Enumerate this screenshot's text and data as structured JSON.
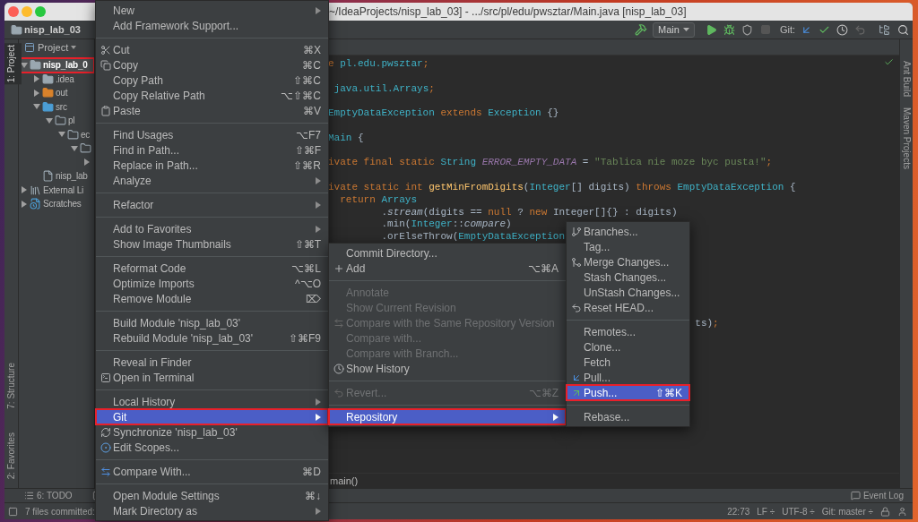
{
  "window": {
    "title": "~/IdeaProjects/nisp_lab_03] - .../src/pl/edu/pwsztar/Main.java [nisp_lab_03]"
  },
  "navbar": {
    "project": "nisp_lab_03",
    "run_config": "Main",
    "git_label": "Git:"
  },
  "left_stripe": {
    "top": [
      {
        "label": "1: Project",
        "selected": true
      }
    ],
    "bottom": [
      {
        "label": "7: Structure",
        "selected": false
      },
      {
        "label": "2: Favorites",
        "selected": false
      }
    ]
  },
  "right_stripe": [
    {
      "label": "Ant Build"
    },
    {
      "label": "Maven Projects"
    }
  ],
  "project_panel": {
    "header": "Project",
    "tree": [
      {
        "kind": "module",
        "label": "nisp_lab_0",
        "expanded": true,
        "marked": true,
        "children": [
          {
            "kind": "folder",
            "label": ".idea",
            "expanded": false
          },
          {
            "kind": "output",
            "label": "out",
            "expanded": false
          },
          {
            "kind": "source",
            "label": "src",
            "expanded": true,
            "children": [
              {
                "kind": "package",
                "label": "pl",
                "expanded": true,
                "children": [
                  {
                    "kind": "package",
                    "label": "ec",
                    "expanded": true,
                    "children": [
                      {
                        "kind": "package",
                        "expanded": true,
                        "children": [
                          {
                            "expanded": false
                          }
                        ]
                      }
                    ]
                  }
                ]
              }
            ]
          },
          {
            "kind": "file",
            "label": "nisp_lab"
          }
        ]
      },
      {
        "kind": "library",
        "label": "External Li",
        "expanded": false
      },
      {
        "kind": "scratches",
        "label": "Scratches",
        "expanded": false
      }
    ]
  },
  "editor": {
    "lines": [
      {
        "kind": "code",
        "tokens": [
          {
            "text": "e",
            "kind": "keyword"
          },
          {
            "text": " pl.edu.pwsztar",
            "kind": "type"
          },
          {
            "text": ";",
            "kind": "keyword"
          }
        ]
      },
      {
        "kind": "blank"
      },
      {
        "kind": "code",
        "tokens": [
          {
            "text": " java.util.Arrays",
            "kind": "type"
          },
          {
            "text": ";",
            "kind": "keyword"
          }
        ]
      },
      {
        "kind": "blank"
      },
      {
        "kind": "code",
        "tokens": [
          {
            "text": "EmptyDataException",
            "kind": "type"
          },
          {
            "text": " extends ",
            "kind": "keyword"
          },
          {
            "text": "Exception",
            "kind": "type"
          },
          {
            "text": " {}",
            "kind": "plain"
          }
        ]
      },
      {
        "kind": "blank"
      },
      {
        "kind": "code",
        "tokens": [
          {
            "text": "Main",
            "kind": "type"
          },
          {
            "text": " {",
            "kind": "plain"
          }
        ]
      },
      {
        "kind": "blank"
      },
      {
        "kind": "code",
        "tokens": [
          {
            "text": "ivate final static ",
            "kind": "keyword"
          },
          {
            "text": "String ",
            "kind": "type"
          },
          {
            "text": "ERROR_EMPTY_DATA",
            "kind": "constant"
          },
          {
            "text": " = ",
            "kind": "plain"
          },
          {
            "text": "\"Tablica nie moze byc pusta!\"",
            "kind": "string"
          },
          {
            "text": ";",
            "kind": "keyword"
          }
        ]
      },
      {
        "kind": "blank"
      },
      {
        "kind": "code",
        "tokens": [
          {
            "text": "ivate static int ",
            "kind": "keyword"
          },
          {
            "text": "getMinFromDigits",
            "kind": "method"
          },
          {
            "text": "(",
            "kind": "plain"
          },
          {
            "text": "Integer",
            "kind": "type"
          },
          {
            "text": "[] digits) ",
            "kind": "plain"
          },
          {
            "text": "throws ",
            "kind": "keyword"
          },
          {
            "text": "EmptyDataException",
            "kind": "type"
          },
          {
            "text": " {",
            "kind": "plain"
          }
        ]
      },
      {
        "kind": "code",
        "tokens": [
          {
            "text": "  return ",
            "kind": "keyword"
          },
          {
            "text": "Arrays",
            "kind": "type"
          }
        ]
      },
      {
        "kind": "code",
        "tokens": [
          {
            "text": "         .",
            "kind": "plain"
          },
          {
            "text": "stream",
            "kind": "italic"
          },
          {
            "text": "(digits == ",
            "kind": "plain"
          },
          {
            "text": "null",
            "kind": "keyword"
          },
          {
            "text": " ? ",
            "kind": "plain"
          },
          {
            "text": "new ",
            "kind": "keyword"
          },
          {
            "text": "Integer[]{} : digits)",
            "kind": "plain"
          }
        ]
      },
      {
        "kind": "code",
        "tokens": [
          {
            "text": "         .min(",
            "kind": "plain"
          },
          {
            "text": "Integer",
            "kind": "type"
          },
          {
            "text": "::",
            "kind": "plain"
          },
          {
            "text": "compare",
            "kind": "italic"
          },
          {
            "text": ")",
            "kind": "plain"
          }
        ]
      },
      {
        "kind": "code",
        "tokens": [
          {
            "text": "         .orElseThrow(",
            "kind": "plain"
          },
          {
            "text": "EmptyDataException",
            "kind": "type"
          }
        ]
      },
      {
        "kind": "blank"
      },
      {
        "kind": "blank"
      },
      {
        "kind": "blank"
      },
      {
        "kind": "blank"
      },
      {
        "kind": "blank"
      },
      {
        "kind": "blank"
      },
      {
        "kind": "code",
        "tokens": [
          {
            "text": "                                                              ts)",
            "kind": "plain"
          },
          {
            "text": ";",
            "kind": "keyword"
          }
        ]
      }
    ],
    "breadcrumb": "main()"
  },
  "bottom_bar": {
    "todo": "6: TODO",
    "event_log": "Event Log"
  },
  "status_bar": {
    "message": "7 files committed:",
    "position": "22:73",
    "line_separator": "LF ÷",
    "encoding": "UTF-8 ÷",
    "vcs": "Git: master ÷"
  },
  "context_menu": {
    "groups": [
      [
        {
          "label": "New",
          "submenu": true,
          "selected": false
        },
        {
          "label": "Add Framework Support...",
          "selected": false
        }
      ],
      [
        {
          "label": "Cut",
          "shortcut": "⌘X",
          "selected": false
        },
        {
          "label": "Copy",
          "shortcut": "⌘C",
          "selected": false
        },
        {
          "label": "Copy Path",
          "shortcut": "⇧⌘C",
          "selected": false
        },
        {
          "label": "Copy Relative Path",
          "shortcut": "⌥⇧⌘C",
          "selected": false
        },
        {
          "label": "Paste",
          "shortcut": "⌘V",
          "selected": false
        }
      ],
      [
        {
          "label": "Find Usages",
          "shortcut": "⌥F7",
          "selected": false
        },
        {
          "label": "Find in Path...",
          "shortcut": "⇧⌘F",
          "selected": false
        },
        {
          "label": "Replace in Path...",
          "shortcut": "⇧⌘R",
          "selected": false
        },
        {
          "label": "Analyze",
          "submenu": true,
          "selected": false
        }
      ],
      [
        {
          "label": "Refactor",
          "submenu": true,
          "selected": false
        }
      ],
      [
        {
          "label": "Add to Favorites",
          "submenu": true,
          "selected": false
        },
        {
          "label": "Show Image Thumbnails",
          "shortcut": "⇧⌘T",
          "selected": false
        }
      ],
      [
        {
          "label": "Reformat Code",
          "shortcut": "⌥⌘L",
          "selected": false
        },
        {
          "label": "Optimize Imports",
          "shortcut": "^⌥O",
          "selected": false
        },
        {
          "label": "Remove Module",
          "shortcut": "⌦",
          "selected": false
        }
      ],
      [
        {
          "label": "Build Module 'nisp_lab_03'",
          "selected": false
        },
        {
          "label": "Rebuild Module 'nisp_lab_03'",
          "shortcut": "⇧⌘F9",
          "selected": false
        }
      ],
      [
        {
          "label": "Reveal in Finder",
          "selected": false
        },
        {
          "label": "Open in Terminal",
          "selected": false
        }
      ],
      [
        {
          "label": "Local History",
          "submenu": true,
          "selected": false
        },
        {
          "label": "Git",
          "submenu": true,
          "selected": true,
          "marked": true
        },
        {
          "label": "Synchronize 'nisp_lab_03'",
          "selected": false
        },
        {
          "label": "Edit Scopes...",
          "selected": false
        }
      ],
      [
        {
          "label": "Compare With...",
          "shortcut": "⌘D",
          "selected": false
        }
      ],
      [
        {
          "label": "Open Module Settings",
          "shortcut": "⌘↓",
          "selected": false
        },
        {
          "label": "Mark Directory as",
          "submenu": true,
          "selected": false
        }
      ]
    ]
  },
  "git_menu": {
    "groups": [
      [
        {
          "label": "Commit Directory...",
          "disabled": false,
          "selected": false
        },
        {
          "label": "Add",
          "shortcut": "⌥⌘A",
          "disabled": false,
          "selected": false
        }
      ],
      [
        {
          "label": "Annotate",
          "disabled": true,
          "selected": false
        },
        {
          "label": "Show Current Revision",
          "disabled": true,
          "selected": false
        },
        {
          "label": "Compare with the Same Repository Version",
          "disabled": true,
          "selected": false
        },
        {
          "label": "Compare with...",
          "disabled": true,
          "selected": false
        },
        {
          "label": "Compare with Branch...",
          "disabled": true,
          "selected": false
        },
        {
          "label": "Show History",
          "disabled": false,
          "selected": false
        }
      ],
      [
        {
          "label": "Revert...",
          "shortcut": "⌥⌘Z",
          "disabled": true,
          "selected": false
        }
      ],
      [
        {
          "label": "Repository",
          "submenu": true,
          "disabled": false,
          "selected": true,
          "marked": true
        }
      ]
    ]
  },
  "repository_menu": {
    "groups": [
      [
        {
          "label": "Branches...",
          "selected": false
        },
        {
          "label": "Tag...",
          "selected": false
        },
        {
          "label": "Merge Changes...",
          "selected": false
        },
        {
          "label": "Stash Changes...",
          "selected": false
        },
        {
          "label": "UnStash Changes...",
          "selected": false
        },
        {
          "label": "Reset HEAD...",
          "selected": false
        }
      ],
      [
        {
          "label": "Remotes...",
          "selected": false
        },
        {
          "label": "Clone...",
          "selected": false
        },
        {
          "label": "Fetch",
          "selected": false
        },
        {
          "label": "Pull...",
          "selected": false
        },
        {
          "label": "Push...",
          "shortcut": "⇧⌘K",
          "selected": true,
          "marked": true
        }
      ],
      [
        {
          "label": "Rebase...",
          "selected": false
        }
      ]
    ]
  }
}
